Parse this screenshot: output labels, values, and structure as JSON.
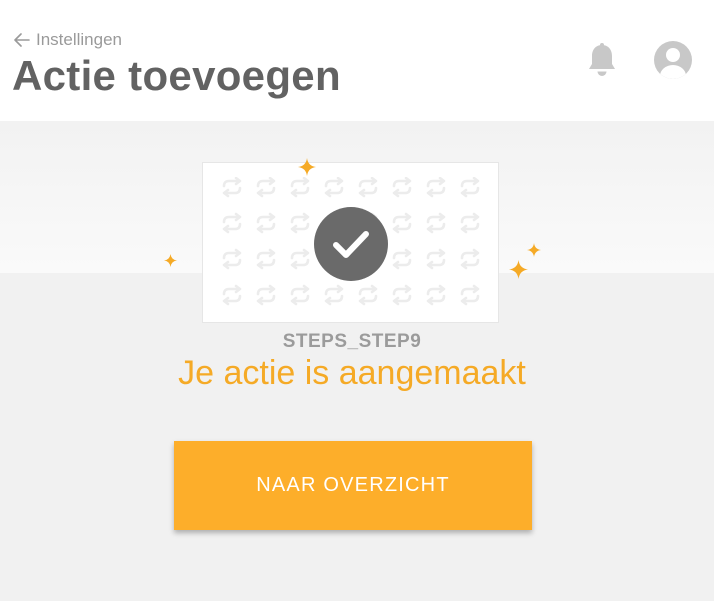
{
  "header": {
    "back_label": "Instellingen",
    "title": "Actie toevoegen",
    "notification_icon": "bell-icon",
    "account_icon": "user-avatar-icon"
  },
  "illustration": {
    "pattern_icon": "repeat-arrows-icon",
    "status_icon": "checkmark-icon",
    "decoration_icon": "sparkle-icon"
  },
  "main": {
    "step_label": "STEPS_STEP9",
    "success_message": "Je actie is aangemaakt",
    "primary_button_label": "NAAR OVERZICHT"
  },
  "colors": {
    "accent": "#fdae2a",
    "success_text": "#f5aa26",
    "title_text": "#626262",
    "muted_text": "#9b9b9b",
    "icon_gray": "#c8c8c8",
    "check_circle": "#6a6a6a",
    "background": "#f1f1f1"
  }
}
